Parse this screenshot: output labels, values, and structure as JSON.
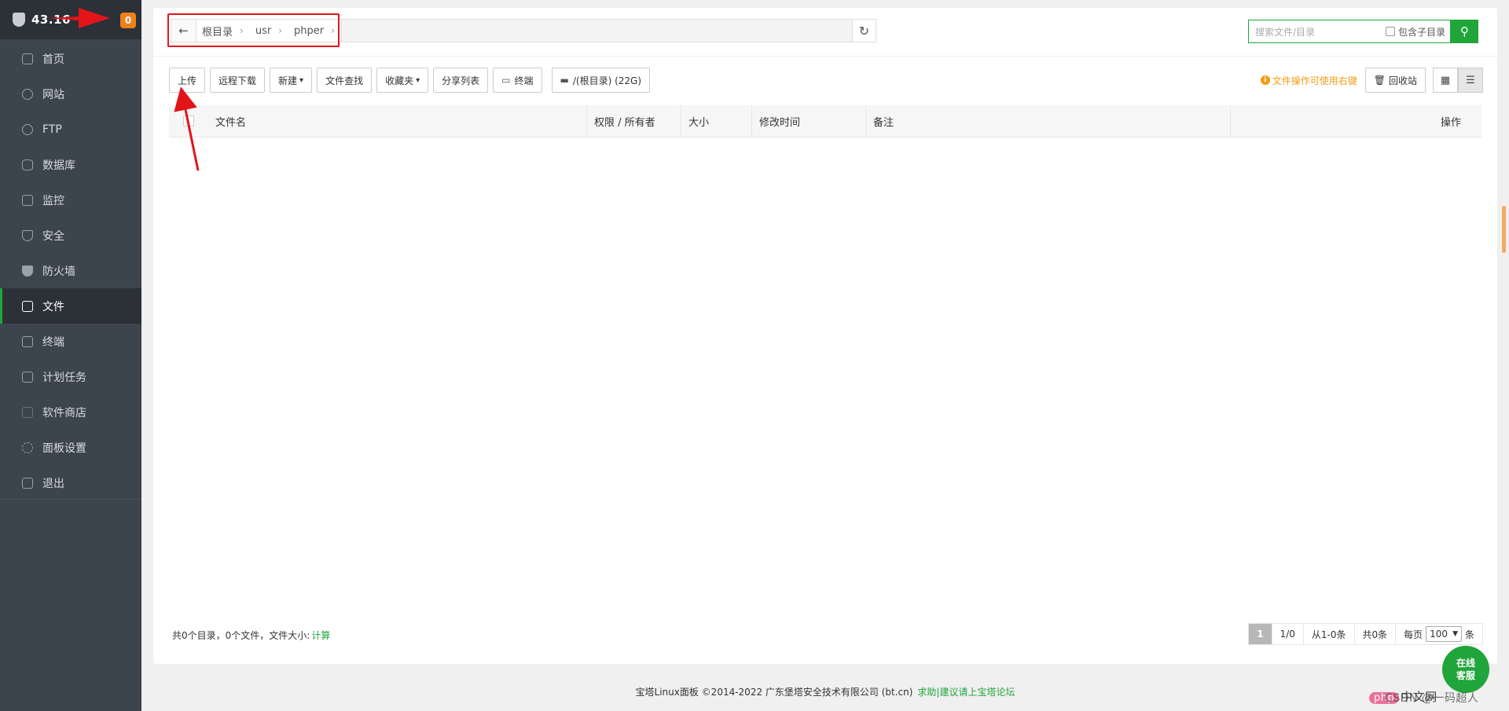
{
  "sidebar": {
    "host": "43.16",
    "badge": "0",
    "items": [
      {
        "label": "首页"
      },
      {
        "label": "网站"
      },
      {
        "label": "FTP"
      },
      {
        "label": "数据库"
      },
      {
        "label": "监控"
      },
      {
        "label": "安全"
      },
      {
        "label": "防火墙"
      },
      {
        "label": "文件"
      },
      {
        "label": "终端"
      },
      {
        "label": "计划任务"
      },
      {
        "label": "软件商店"
      },
      {
        "label": "面板设置"
      },
      {
        "label": "退出"
      }
    ],
    "active_index": 7
  },
  "path": {
    "back_icon": "←",
    "crumbs": [
      "根目录",
      "usr",
      "phper"
    ],
    "separator": "›",
    "refresh_icon": "↻"
  },
  "search": {
    "placeholder": "搜索文件/目录",
    "include_sub_label": "包含子目录",
    "button_icon": "⚲"
  },
  "toolbar": {
    "upload": "上传",
    "remote_download": "远程下载",
    "new": "新建",
    "find": "文件查找",
    "favorites": "收藏夹",
    "share_list": "分享列表",
    "terminal": "终端",
    "disk": "/(根目录) (22G)",
    "tip": "文件操作可使用右键",
    "recycle": "回收站"
  },
  "table": {
    "columns": [
      "文件名",
      "权限 / 所有者",
      "大小",
      "修改时间",
      "备注",
      "操作"
    ]
  },
  "stats": {
    "text": "共0个目录，0个文件，文件大小:",
    "calc": "计算"
  },
  "pager": {
    "current": "1",
    "pages": "1/0",
    "range": "从1-0条",
    "total": "共0条",
    "per_page_label": "每页",
    "per_page": "100",
    "unit": "条"
  },
  "footer": {
    "copyright": "宝塔Linux面板 ©2014-2022 广东堡塔安全技术有限公司 (bt.cn)",
    "link": "求助|建议请上宝塔论坛"
  },
  "service": {
    "line1": "在线",
    "line2": "客服"
  },
  "watermark": {
    "badge": "php",
    "text": "中文网",
    "text2": "CSDN @一码超人"
  },
  "colors": {
    "accent": "#20a53a",
    "annotation": "#e2141a",
    "warning": "#f39c12"
  }
}
